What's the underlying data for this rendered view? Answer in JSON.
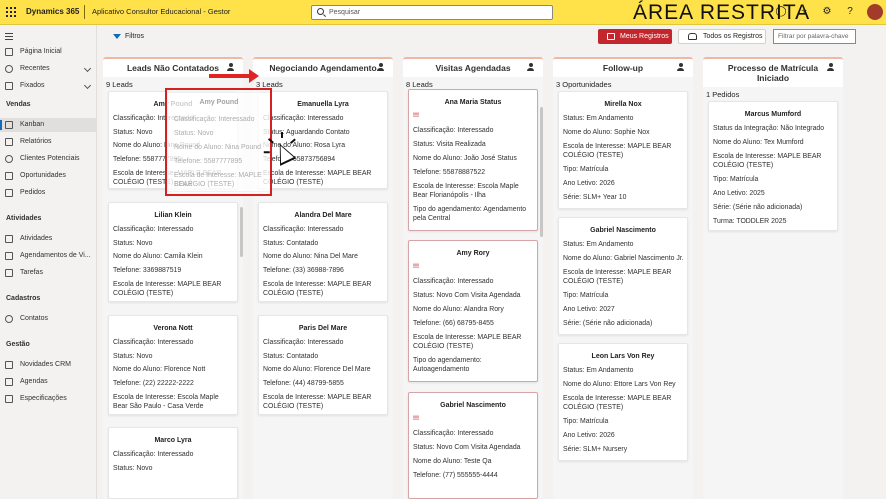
{
  "topbar": {
    "brand": "Dynamics 365",
    "app_name": "Aplicativo Consultor Educacional - Gestor",
    "search_placeholder": "Pesquisar",
    "restricted_label": "ÁREA RESTRITA"
  },
  "sidebar": {
    "items": [
      {
        "label": "Página Inicial"
      },
      {
        "label": "Recentes"
      },
      {
        "label": "Fixados"
      },
      {
        "label": "Kanban"
      },
      {
        "label": "Relatórios"
      },
      {
        "label": "Clientes Potenciais"
      },
      {
        "label": "Oportunidades"
      },
      {
        "label": "Pedidos"
      },
      {
        "label": "Atividades"
      },
      {
        "label": "Agendamentos de Vi..."
      },
      {
        "label": "Tarefas"
      },
      {
        "label": "Contatos"
      },
      {
        "label": "Novidades CRM"
      },
      {
        "label": "Agendas"
      },
      {
        "label": "Especificações"
      }
    ],
    "groups": [
      "Vendas",
      "Atividades",
      "Cadastros",
      "Gestão"
    ]
  },
  "toolbar": {
    "filters_label": "Filtros",
    "my_records_label": "Meus Registros",
    "all_records_label": "Todos os Registros",
    "filter_placeholder": "Filtrar por palavra-chave"
  },
  "columns": [
    {
      "title": "Leads Não Contatados",
      "count": "9 Leads",
      "cards": [
        {
          "name": "Amy Pound",
          "lines": [
            "Classificação: Interessado",
            "Status: Novo",
            "Nome do Aluno: Nina Pound",
            "Telefone: 5587777895",
            "Escola de Interesse: MAPLE BEAR",
            "COLÉGIO (TESTE)"
          ]
        },
        {
          "name": "Lilian Klein",
          "lines": [
            "Classificação: Interessado",
            "Status: Novo",
            "Nome do Aluno: Camila Klein",
            "Telefone: 3369887519",
            "Escola de Interesse: MAPLE BEAR",
            "COLÉGIO (TESTE)"
          ]
        },
        {
          "name": "Verona Nott",
          "lines": [
            "Classificação: Interessado",
            "Status: Novo",
            "Nome do Aluno: Florence Nott",
            "Telefone: (22) 22222-2222",
            "Escola de Interesse: Escola Maple",
            "Bear São Paulo - Casa Verde"
          ]
        },
        {
          "name": "Marco Lyra",
          "lines": [
            "Classificação: Interessado",
            "Status: Novo"
          ]
        }
      ]
    },
    {
      "title": "Negociando Agendamento",
      "count": "3 Leads",
      "cards": [
        {
          "name": "Emanuella Lyra",
          "lines": [
            "Classificação: Interessado",
            "Status: Aguardando Contato",
            "Nome do Aluno: Rosa Lyra",
            "Telefone: 55873756894",
            "Escola de Interesse: MAPLE BEAR",
            "COLÉGIO (TESTE)"
          ]
        },
        {
          "name": "Alandra Del Mare",
          "lines": [
            "Classificação: Interessado",
            "Status: Contatado",
            "Nome do Aluno: Nina Del Mare",
            "Telefone: (33) 36988-7896",
            "Escola de Interesse: MAPLE BEAR",
            "COLÉGIO (TESTE)"
          ]
        },
        {
          "name": "Paris Del Mare",
          "lines": [
            "Classificação: Interessado",
            "Status: Contatado",
            "Nome do Aluno: Florence Del Mare",
            "Telefone: (44) 48799-5855",
            "Escola de Interesse: MAPLE BEAR",
            "COLÉGIO (TESTE)"
          ]
        }
      ]
    },
    {
      "title": "Visitas Agendadas",
      "count": "8 Leads",
      "cards": [
        {
          "name": "Ana Maria Status",
          "excl": "!!!",
          "lines": [
            "Classificação: Interessado",
            "Status: Visita Realizada",
            "Nome do Aluno: João José Status",
            "Telefone: 55878887522",
            "Escola de Interesse: Escola Maple",
            "Bear Florianópolis - Ilha",
            "Tipo do agendamento: Agendamento",
            "pela Central"
          ]
        },
        {
          "name": "Amy Rory",
          "excl": "!!!",
          "lines": [
            "Classificação: Interessado",
            "Status: Novo Com Visita Agendada",
            "Nome do Aluno: Alandra Rory",
            "Telefone: (66) 68795-8455",
            "Escola de Interesse: MAPLE BEAR",
            "COLÉGIO (TESTE)",
            "Tipo do agendamento:",
            "Autoagendamento"
          ]
        },
        {
          "name": "Gabriel Nascimento",
          "excl": "!!!",
          "lines": [
            "Classificação: Interessado",
            "Status: Novo Com Visita Agendada",
            "Nome do Aluno: Teste Qa",
            "Telefone: (77) 555555-4444"
          ]
        }
      ]
    },
    {
      "title": "Follow-up",
      "count": "3 Oportunidades",
      "cards": [
        {
          "name": "Mirella Nox",
          "lines": [
            "Status: Em Andamento",
            "Nome do Aluno: Sophie Nox",
            "Escola de Interesse: MAPLE BEAR",
            "COLÉGIO (TESTE)",
            "Tipo: Matrícula",
            "Ano Letivo: 2026",
            "Série: SLM+ Year 10"
          ]
        },
        {
          "name": "Gabriel Nascimento",
          "lines": [
            "Status: Em Andamento",
            "Nome do Aluno: Gabriel Nascimento Jr.",
            "Escola de Interesse: MAPLE BEAR",
            "COLÉGIO (TESTE)",
            "Tipo: Matrícula",
            "Ano Letivo: 2027",
            "Série: (Série não adicionada)"
          ]
        },
        {
          "name": "Leon Lars Von Rey",
          "lines": [
            "Status: Em Andamento",
            "Nome do Aluno: Ettore Lars Von Rey",
            "Escola de Interesse: MAPLE BEAR",
            "COLÉGIO (TESTE)",
            "Tipo: Matrícula",
            "Ano Letivo: 2026",
            "Série: SLM+ Nursery"
          ]
        }
      ]
    },
    {
      "title": "Processo de Matrícula Iniciado",
      "count": "1 Pedidos",
      "cards": [
        {
          "name": "Marcus Mumford",
          "lines": [
            "Status da Integração: Não Integrado",
            "Nome do Aluno: Tex Mumford",
            "Escola de Interesse: MAPLE BEAR",
            "COLÉGIO (TESTE)",
            "Tipo: Matrícula",
            "Ano Letivo: 2025",
            "Série: (Série não adicionada)",
            "Turma: TODDLER 2025"
          ]
        }
      ]
    }
  ],
  "drag_ghost": {
    "name": "Amy Pound",
    "lines": [
      "Classificação: Interessado",
      "Status: Novo",
      "Nome do Aluno: Nina Pound",
      "Telefone: 5587777895",
      "Escola de Interesse: MAPLE BEAR",
      "COLÉGIO (TESTE)"
    ]
  }
}
